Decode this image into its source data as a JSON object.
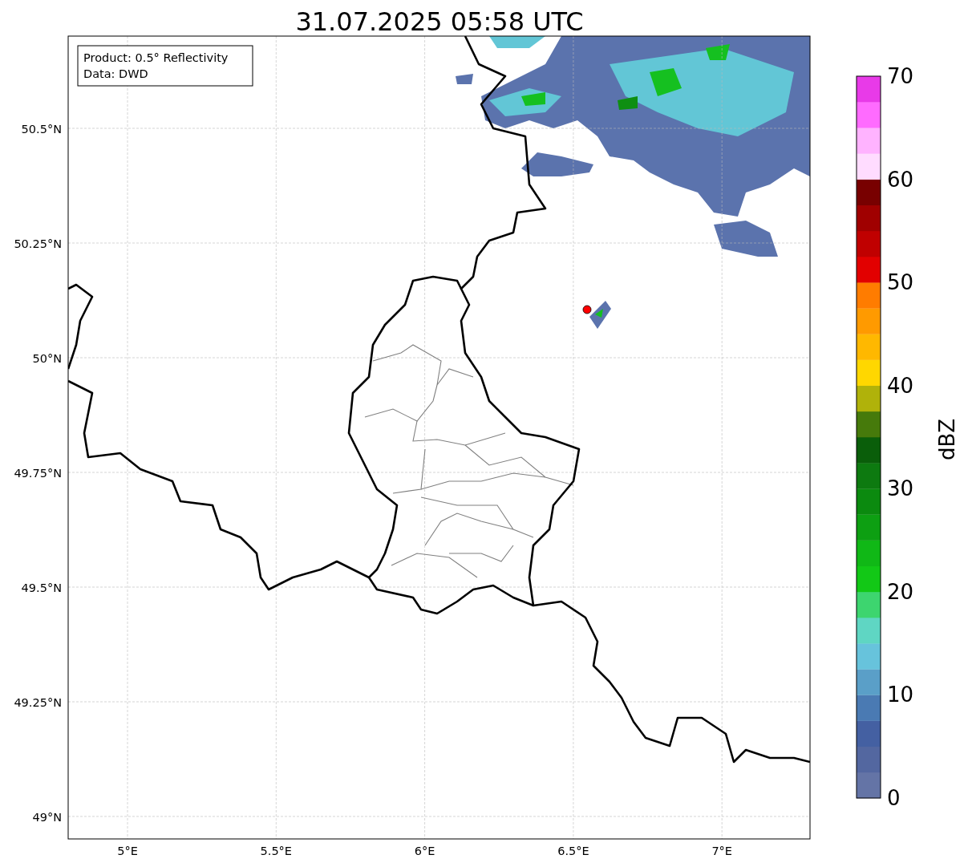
{
  "title": "31.07.2025 05:58 UTC",
  "map": {
    "info_box": [
      "Product: 0.5° Reflectivity",
      "Data: DWD"
    ],
    "lat_labels": [
      "50.5°N",
      "50.25°N",
      "50°N",
      "49.75°N",
      "49.5°N",
      "49.25°N",
      "49°N"
    ],
    "lon_labels": [
      "5°E",
      "5.5°E",
      "6°E",
      "6.5°E",
      "7°E"
    ]
  },
  "colorbar": {
    "label": "dBZ",
    "ticks": [
      "70",
      "60",
      "50",
      "40",
      "30",
      "20",
      "10",
      "0"
    ],
    "bands": [
      {
        "color": "#6474a6"
      },
      {
        "color": "#5367a0"
      },
      {
        "color": "#4460a2"
      },
      {
        "color": "#4a7ab3"
      },
      {
        "color": "#5a9fc8"
      },
      {
        "color": "#67c3dc"
      },
      {
        "color": "#5fd6c3"
      },
      {
        "color": "#3dd56f"
      },
      {
        "color": "#12c816"
      },
      {
        "color": "#10b816"
      },
      {
        "color": "#0d9f12"
      },
      {
        "color": "#0b8a0f"
      },
      {
        "color": "#0d7a10"
      },
      {
        "color": "#0a5e0a"
      },
      {
        "color": "#467a0b"
      },
      {
        "color": "#b0b20a"
      },
      {
        "color": "#ffd700"
      },
      {
        "color": "#ffb800"
      },
      {
        "color": "#ff9a00"
      },
      {
        "color": "#ff7c00"
      },
      {
        "color": "#e20000"
      },
      {
        "color": "#c00000"
      },
      {
        "color": "#a00000"
      },
      {
        "color": "#780000"
      },
      {
        "color": "#ffdcff"
      },
      {
        "color": "#ffb3ff"
      },
      {
        "color": "#ff6bff"
      },
      {
        "color": "#e83ae8"
      }
    ]
  }
}
